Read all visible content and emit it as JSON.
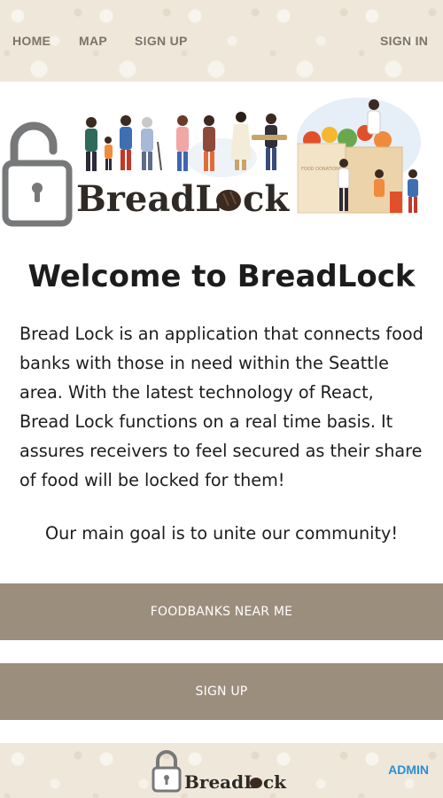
{
  "nav": {
    "home": "HOME",
    "map": "MAP",
    "signup": "SIGN UP",
    "signin": "SIGN IN"
  },
  "banner": {
    "brand_prefix": "BreadL",
    "brand_suffix": "ck",
    "box_text": "FOOD DONATIONS"
  },
  "main": {
    "title": "Welcome to BreadLock",
    "description": "Bread Lock is an application that connects food banks with those in need within the Seattle area. With the latest technology of React, Bread Lock functions on a real time basis. It assures receivers to feel secured as their share of food will be locked for them!",
    "goal": "Our main goal is to unite our community!"
  },
  "buttons": {
    "foodbanks": "FOODBANKS NEAR ME",
    "signup": "SIGN UP"
  },
  "footer": {
    "brand_prefix": "BreadL",
    "brand_suffix": "ck",
    "admin": "ADMIN"
  },
  "colors": {
    "button_bg": "#9c8e7d",
    "pattern_bg": "#efe7da",
    "link_blue": "#2a8fd6",
    "brand_text": "#2f2a25",
    "lock_gray": "#77787a"
  }
}
